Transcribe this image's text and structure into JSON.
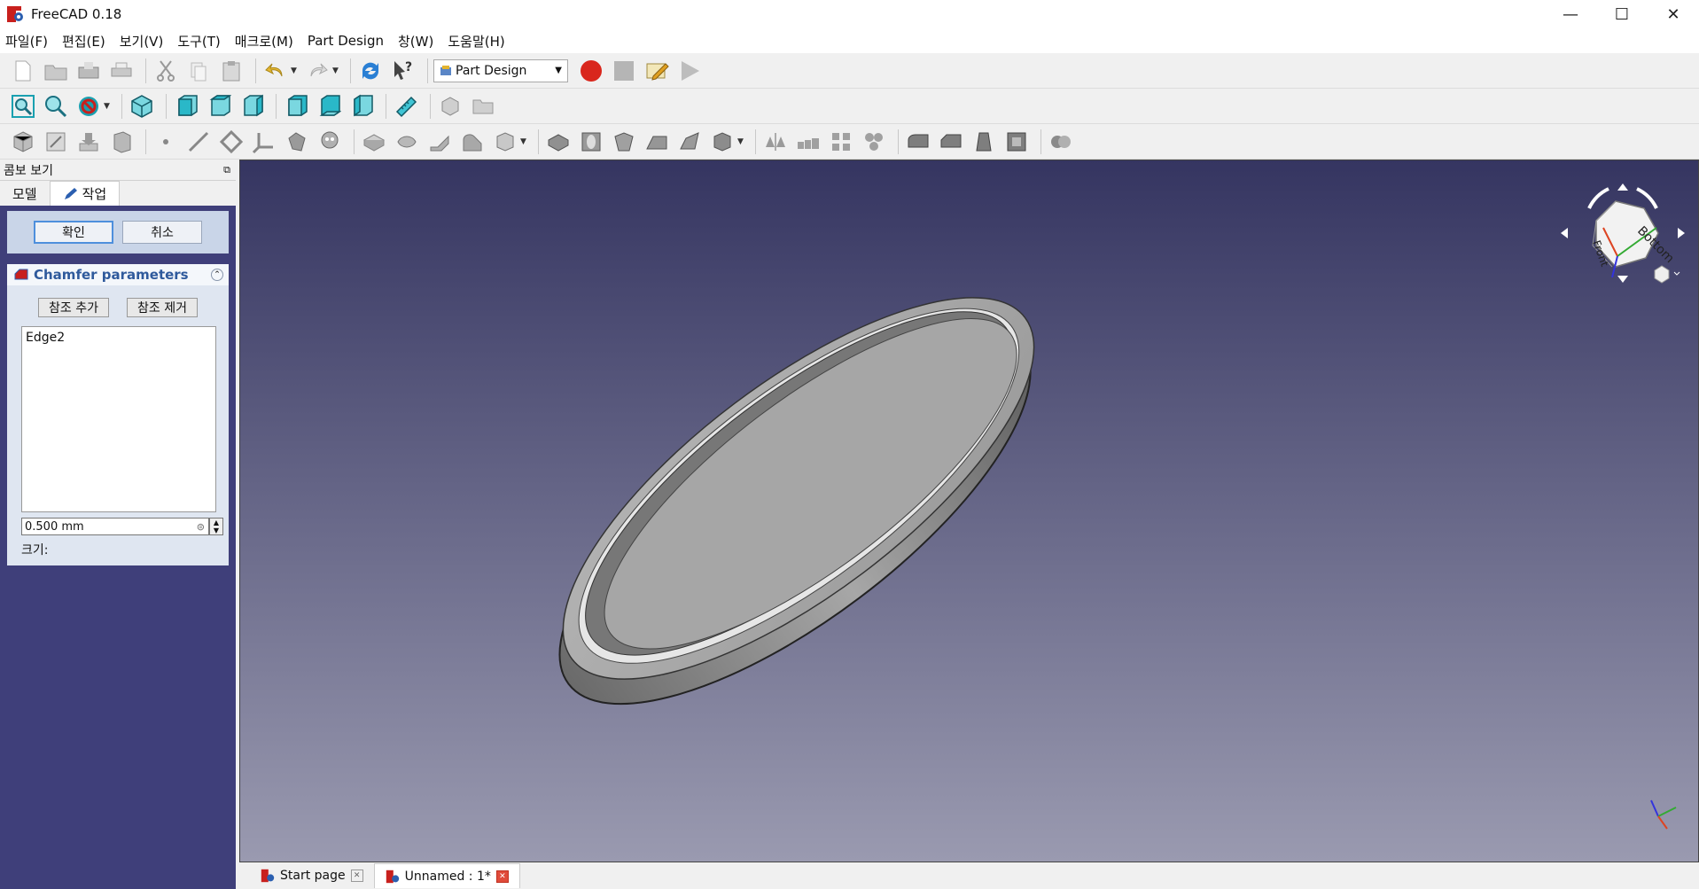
{
  "window": {
    "title": "FreeCAD 0.18",
    "minimize": "—",
    "maximize": "☐",
    "close": "✕"
  },
  "menu": [
    "파일(F)",
    "편집(E)",
    "보기(V)",
    "도구(T)",
    "매크로(M)",
    "Part Design",
    "창(W)",
    "도움말(H)"
  ],
  "workbench": {
    "selected": "Part Design"
  },
  "combo": {
    "title": "콤보 보기",
    "tab_model": "모델",
    "tab_task": "작업"
  },
  "task": {
    "ok": "확인",
    "cancel": "취소",
    "chamfer_title": "Chamfer parameters",
    "add_ref": "참조 추가",
    "remove_ref": "참조 제거",
    "edges": [
      "Edge2"
    ],
    "size_value": "0.500 mm",
    "size_label": "크기:"
  },
  "navcube": {
    "top_face": "Bottom",
    "front_face": "Front"
  },
  "doc_tabs": {
    "start": "Start page",
    "unnamed": "Unnamed : 1*"
  },
  "colors": {
    "accent": "#4e8fdc",
    "record": "#d9261c",
    "panel_bg": "#3f3f7a"
  }
}
